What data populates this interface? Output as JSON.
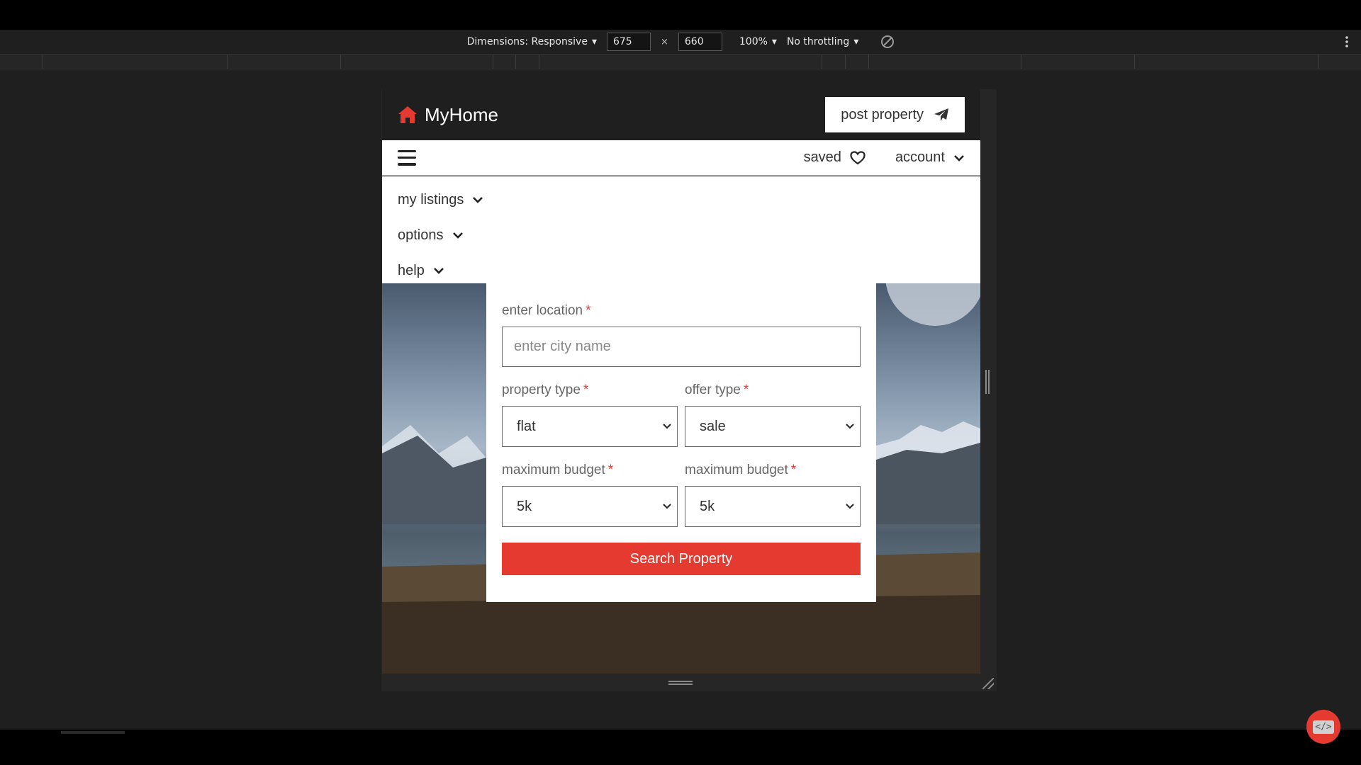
{
  "devtools": {
    "dimensions_label": "Dimensions: Responsive",
    "width_value": "675",
    "height_value": "660",
    "times": "×",
    "zoom": "100%",
    "throttling": "No throttling"
  },
  "site": {
    "brand": "MyHome",
    "post_property": "post property",
    "nav": {
      "saved": "saved",
      "account": "account"
    },
    "menu_items": [
      {
        "label": "my listings"
      },
      {
        "label": "options"
      },
      {
        "label": "help"
      }
    ]
  },
  "search_form": {
    "location_label": "enter location",
    "location_placeholder": "enter city name",
    "required_mark": "*",
    "property_type_label": "property type",
    "property_type_value": "flat",
    "offer_type_label": "offer type",
    "offer_type_value": "sale",
    "budget_left_label": "maximum budget",
    "budget_left_value": "5k",
    "budget_right_label": "maximum budget",
    "budget_right_value": "5k",
    "submit_label": "Search Property"
  },
  "fab": {
    "label": "</>"
  },
  "colors": {
    "accent": "#e53a2f",
    "header_bg": "#1f1f1f"
  },
  "icons": {
    "brand": "home-icon",
    "post": "paper-plane-icon",
    "saved": "heart-icon",
    "dropdown": "chevron-down-icon"
  }
}
